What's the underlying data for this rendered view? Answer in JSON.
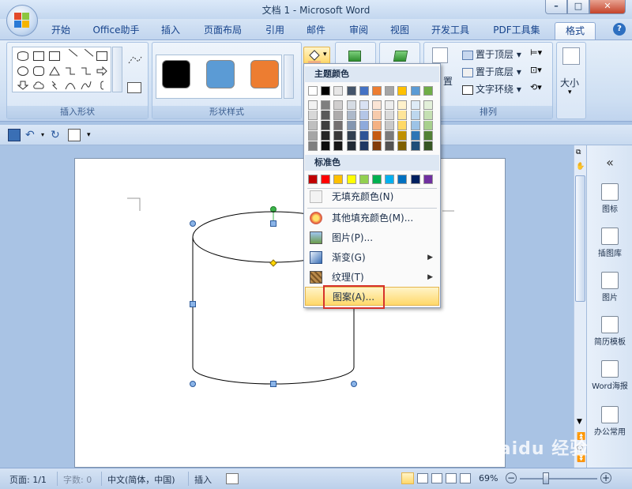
{
  "window": {
    "title": "文档 1 - Microsoft Word"
  },
  "tabs": [
    {
      "label": "开始"
    },
    {
      "label": "Office助手"
    },
    {
      "label": "插入"
    },
    {
      "label": "页面布局"
    },
    {
      "label": "引用"
    },
    {
      "label": "邮件"
    },
    {
      "label": "审阅"
    },
    {
      "label": "视图"
    },
    {
      "label": "开发工具"
    },
    {
      "label": "PDF工具集"
    },
    {
      "label": "格式"
    }
  ],
  "help_label": "?",
  "ribbon": {
    "insert_shapes_label": "插入形状",
    "shape_styles_label": "形状样式",
    "arrange_label": "排列",
    "arrange": {
      "bring_front": "置于顶层",
      "send_back": "置于底层",
      "text_wrap": "文字环绕",
      "position_partial": "置"
    },
    "size_label": "大小",
    "style_colors": [
      "#000000",
      "#5b9bd5",
      "#ed7d31"
    ]
  },
  "fill_menu": {
    "theme_colors_header": "主题颜色",
    "theme_colors_top": [
      "#ffffff",
      "#000000",
      "#e7e6e6",
      "#44546a",
      "#4472c4",
      "#ed7d31",
      "#a5a5a5",
      "#ffc000",
      "#5b9bd5",
      "#70ad47"
    ],
    "theme_shades": [
      [
        "#f2f2f2",
        "#7f7f7f",
        "#d0cece",
        "#d6dce4",
        "#d9e2f3",
        "#fbe5d5",
        "#ededed",
        "#fff2cc",
        "#deebf6",
        "#e2efd9"
      ],
      [
        "#d8d8d8",
        "#595959",
        "#aeabab",
        "#adb9ca",
        "#b4c6e7",
        "#f7cbac",
        "#dbdbdb",
        "#fee599",
        "#bdd7ee",
        "#c5e0b3"
      ],
      [
        "#bfbfbf",
        "#3f3f3f",
        "#757070",
        "#8496b0",
        "#8eaadb",
        "#f4b183",
        "#c9c9c9",
        "#ffd965",
        "#9dc3e6",
        "#a8d08d"
      ],
      [
        "#a5a5a5",
        "#262626",
        "#3a3838",
        "#323f4f",
        "#2f5496",
        "#c55a11",
        "#7b7b7b",
        "#bf9000",
        "#2e75b5",
        "#538135"
      ],
      [
        "#7f7f7f",
        "#0c0c0c",
        "#171616",
        "#222a35",
        "#1f3864",
        "#833c0b",
        "#525252",
        "#7f6000",
        "#1e4e79",
        "#375623"
      ]
    ],
    "standard_colors_header": "标准色",
    "standard_colors": [
      "#c00000",
      "#ff0000",
      "#ffc000",
      "#ffff00",
      "#92d050",
      "#00b050",
      "#00b0f0",
      "#0070c0",
      "#002060",
      "#7030a0"
    ],
    "items": [
      {
        "label": "无填充颜色(N)",
        "icon": "no-fill-icon",
        "submenu": false
      },
      {
        "label": "其他填充颜色(M)...",
        "icon": "palette-icon",
        "submenu": false
      },
      {
        "label": "图片(P)...",
        "icon": "picture-icon",
        "submenu": false
      },
      {
        "label": "渐变(G)",
        "icon": "gradient-icon",
        "submenu": true
      },
      {
        "label": "纹理(T)",
        "icon": "texture-icon",
        "submenu": true
      },
      {
        "label": "图案(A)...",
        "icon": "pattern-icon",
        "submenu": false
      }
    ]
  },
  "sidebar": {
    "collapse": "«",
    "items": [
      {
        "label": "图标"
      },
      {
        "label": "插图库"
      },
      {
        "label": "图片"
      },
      {
        "label": "简历模板"
      },
      {
        "label": "Word海报"
      },
      {
        "label": "办公常用"
      }
    ]
  },
  "statusbar": {
    "page": "页面: 1/1",
    "words": "字数: 0",
    "language": "中文(简体，中国)",
    "mode": "插入",
    "zoom": "69%"
  },
  "watermark": "Baidu 经验"
}
